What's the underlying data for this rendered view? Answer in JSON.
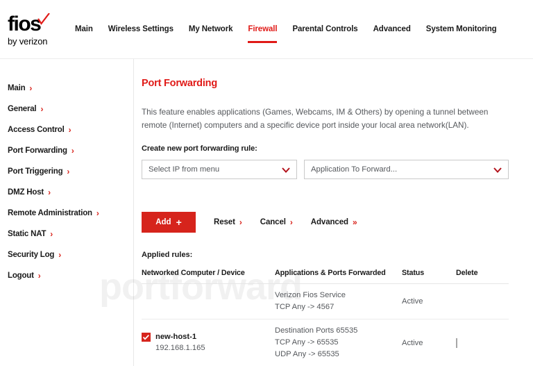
{
  "brand": {
    "logo_text": "fios",
    "logo_sub": "by verizon",
    "accent_red": "#e01a17",
    "button_red": "#d6241c"
  },
  "nav": {
    "items": [
      {
        "label": "Main",
        "active": false
      },
      {
        "label": "Wireless Settings",
        "active": false
      },
      {
        "label": "My Network",
        "active": false
      },
      {
        "label": "Firewall",
        "active": true
      },
      {
        "label": "Parental Controls",
        "active": false
      },
      {
        "label": "Advanced",
        "active": false
      },
      {
        "label": "System Monitoring",
        "active": false
      }
    ]
  },
  "sidebar": {
    "items": [
      {
        "label": "Main"
      },
      {
        "label": "General"
      },
      {
        "label": "Access Control"
      },
      {
        "label": "Port Forwarding"
      },
      {
        "label": "Port Triggering"
      },
      {
        "label": "DMZ Host"
      },
      {
        "label": "Remote Administration"
      },
      {
        "label": "Static NAT"
      },
      {
        "label": "Security Log"
      },
      {
        "label": "Logout"
      }
    ],
    "chevron": "›"
  },
  "main": {
    "title": "Port Forwarding",
    "description": "This feature enables applications (Games, Webcams, IM & Others) by opening a tunnel between remote (Internet) computers and a specific device port inside your local area network(LAN).",
    "create_label": "Create new port forwarding rule:",
    "select_ip": {
      "value": "Select IP from menu"
    },
    "select_app": {
      "value": "Application To Forward..."
    },
    "buttons": {
      "add": "Add",
      "add_plus": "+",
      "reset": "Reset",
      "cancel": "Cancel",
      "advanced": "Advanced",
      "single_chevron": "›",
      "double_chevron": "»"
    },
    "applied_label": "Applied rules:",
    "table": {
      "headers": {
        "device": "Networked Computer / Device",
        "apps": "Applications & Ports Forwarded",
        "status": "Status",
        "delete": "Delete"
      },
      "rows": [
        {
          "device_name": "",
          "device_ip": "",
          "has_checkbox": false,
          "app_lines": [
            "Verizon Fios Service",
            "TCP Any -> 4567"
          ],
          "status": "Active",
          "has_delete": false
        },
        {
          "device_name": "new-host-1",
          "device_ip": "192.168.1.165",
          "has_checkbox": true,
          "app_lines": [
            "Destination Ports 65535",
            "TCP Any -> 65535",
            "UDP Any -> 65535"
          ],
          "status": "Active",
          "has_delete": true
        }
      ]
    }
  },
  "watermark": {
    "text": "portforward"
  }
}
